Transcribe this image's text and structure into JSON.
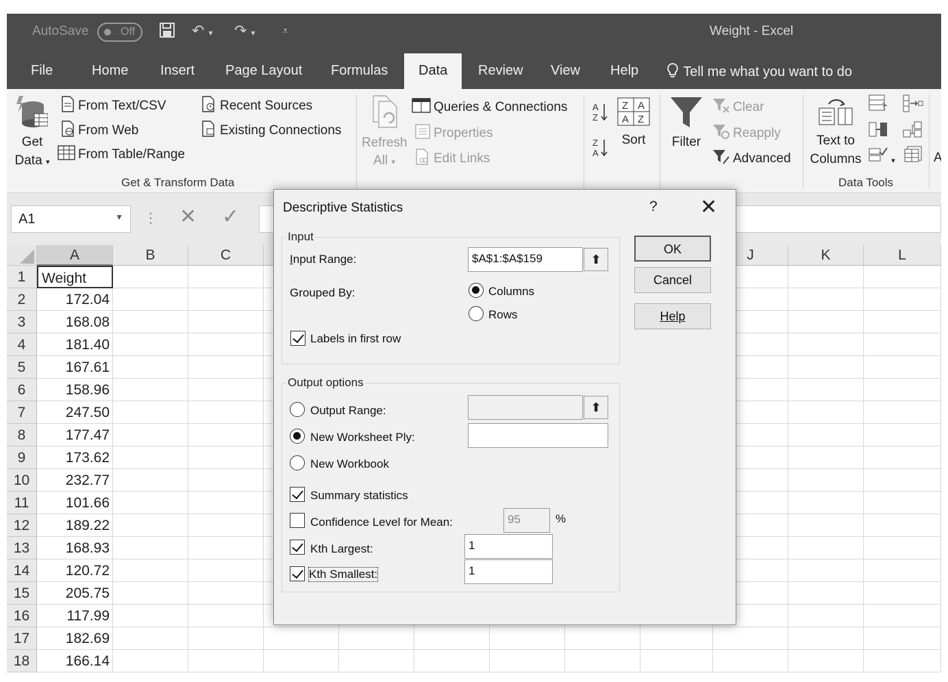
{
  "titlebar": {
    "autosave_label": "AutoSave",
    "autosave_state": "Off",
    "window_title": "Weight  -  Excel"
  },
  "tabs": [
    "File",
    "Home",
    "Insert",
    "Page Layout",
    "Formulas",
    "Data",
    "Review",
    "View",
    "Help"
  ],
  "active_tab": "Data",
  "tell_me": "Tell me what you want to do",
  "ribbon": {
    "get_data": [
      "Get",
      "Data"
    ],
    "from_text_csv": "From Text/CSV",
    "from_web": "From Web",
    "from_table_range": "From Table/Range",
    "recent_sources": "Recent Sources",
    "existing_connections": "Existing Connections",
    "group_get_transform": "Get & Transform Data",
    "refresh_all": [
      "Refresh",
      "All"
    ],
    "queries_connections": "Queries & Connections",
    "properties": "Properties",
    "edit_links": "Edit Links",
    "sort": "Sort",
    "filter": "Filter",
    "clear": "Clear",
    "reapply": "Reapply",
    "advanced": "Advanced",
    "text_to_columns": [
      "Text to",
      "Columns"
    ],
    "group_data_tools": "Data Tools",
    "overflow": "A"
  },
  "formula_bar": {
    "name_box": "A1",
    "formula": ""
  },
  "sheet": {
    "columns": [
      "A",
      "B",
      "C",
      "J",
      "K",
      "L"
    ],
    "row_numbers": [
      "1",
      "2",
      "3",
      "4",
      "5",
      "6",
      "7",
      "8",
      "9",
      "10",
      "11",
      "12",
      "13",
      "14",
      "15",
      "16",
      "17",
      "18"
    ],
    "col_a": [
      "Weight",
      "172.04",
      "168.08",
      "181.40",
      "167.61",
      "158.96",
      "247.50",
      "177.47",
      "173.62",
      "232.77",
      "101.66",
      "189.22",
      "168.93",
      "120.72",
      "205.75",
      "117.99",
      "182.69",
      "166.14"
    ]
  },
  "dialog": {
    "title": "Descriptive Statistics",
    "help_glyph": "?",
    "close_glyph": "✕",
    "input_legend": "Input",
    "input_range_label": "Input Range:",
    "input_range_value": "$A$1:$A$159",
    "grouped_by_label": "Grouped By:",
    "grouped_by_options": [
      "Columns",
      "Rows"
    ],
    "grouped_by_selected": "Columns",
    "labels_first_row": "Labels in first row",
    "labels_first_row_checked": true,
    "output_legend": "Output options",
    "output_range_label": "Output Range:",
    "new_worksheet_label": "New Worksheet Ply:",
    "new_workbook_label": "New Workbook",
    "output_selected": "New Worksheet Ply",
    "summary_statistics": "Summary statistics",
    "summary_statistics_checked": true,
    "confidence_label": "Confidence Level for Mean:",
    "confidence_checked": false,
    "confidence_value": "95",
    "confidence_unit": "%",
    "kth_largest_label": "Kth Largest:",
    "kth_largest_checked": true,
    "kth_largest_value": "1",
    "kth_smallest_label": "Kth Smallest:",
    "kth_smallest_checked": true,
    "kth_smallest_value": "1",
    "ok": "OK",
    "cancel": "Cancel",
    "help": "Help"
  }
}
